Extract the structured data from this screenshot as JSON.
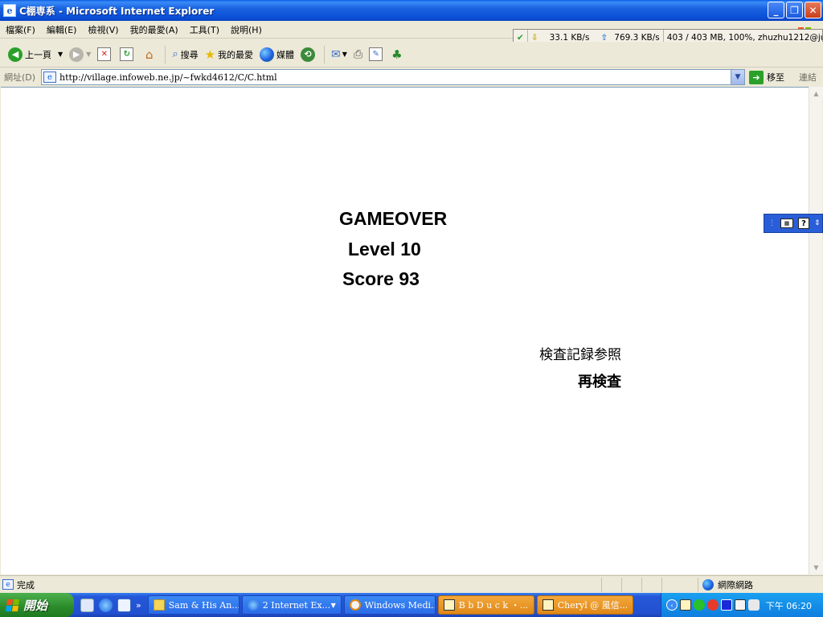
{
  "window": {
    "title": "C棚専系 - Microsoft Internet Explorer",
    "title_icon": "ie-page-icon",
    "minimize": "_",
    "restore": "❐",
    "close": "✕"
  },
  "menu": [
    "檔案(F)",
    "編輯(E)",
    "檢視(V)",
    "我的最愛(A)",
    "工具(T)",
    "說明(H)"
  ],
  "meter": {
    "down_speed": "33.1 KB/s",
    "up_speed": "769.3 KB/s",
    "status": "403 / 403 MB, 100%, zhuzhu1212@ju"
  },
  "toolbar": {
    "back": "上一頁",
    "search": "搜尋",
    "favorites": "我的最愛",
    "media": "媒體"
  },
  "address": {
    "label": "網址(D)",
    "url": "http://village.infoweb.ne.jp/~fwkd4612/C/C.html",
    "go": "移至",
    "links": "連結"
  },
  "game": {
    "title": "GAMEOVER",
    "level": "Level 10",
    "score": "Score 93",
    "history_link": "検査記録参照",
    "retry_link": "再検査"
  },
  "status": {
    "text": "完成",
    "zone": "網際網路"
  },
  "taskbar": {
    "start": "開始",
    "tasks": [
      {
        "label": "Sam & His An...",
        "icon": "folder-icon",
        "flash": false
      },
      {
        "label": "2 Internet Ex...",
        "icon": "ie-icon",
        "flash": false
      },
      {
        "label": "Windows Medi...",
        "icon": "media-player-icon",
        "flash": false
      },
      {
        "label": "B b  D u c k ・...",
        "icon": "chat-window-icon",
        "flash": true
      },
      {
        "label": "Cheryl @ 風信...",
        "icon": "chat-window-icon",
        "flash": true
      }
    ],
    "clock": "下午 06:20"
  },
  "colors": {
    "xp_blue": "#0a4ed6",
    "start_green": "#2a8a2a",
    "flash_orange": "#e08818"
  }
}
